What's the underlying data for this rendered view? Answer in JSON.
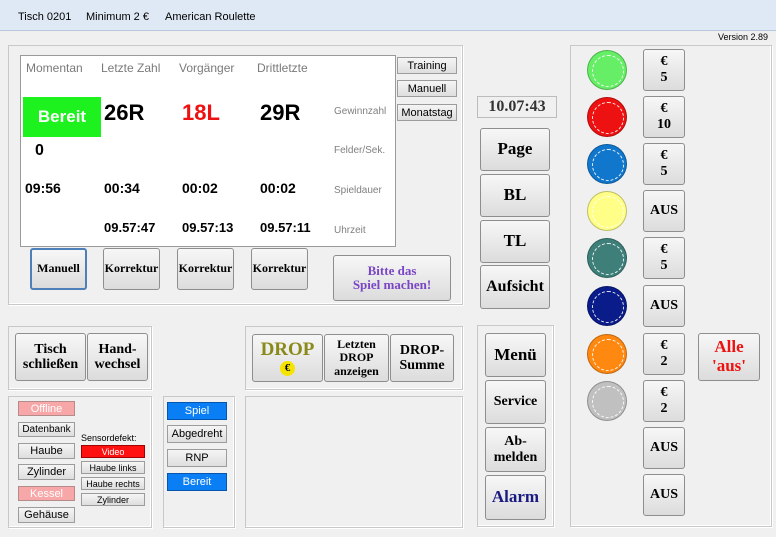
{
  "title": {
    "table": "Tisch 0201",
    "minimum": "Minimum 2 €",
    "game": "American Roulette"
  },
  "version": "Version 2.89",
  "display": {
    "headers": [
      "Momentan",
      "Letzte Zahl",
      "Vorgänger",
      "Drittletzte"
    ],
    "status": "Bereit",
    "numbers": [
      "26R",
      "18L",
      "29R"
    ],
    "number_colors": [
      "#000000",
      "#ee1111",
      "#000000"
    ],
    "fields_per_sec": "0",
    "durations": [
      "09:56",
      "00:34",
      "00:02",
      "00:02"
    ],
    "times": [
      "09.57:47",
      "09.57:13",
      "09.57:11"
    ],
    "row_labels": [
      "Gewinnzahl",
      "Felder/Sek.",
      "Spieldauer",
      "Uhrzeit"
    ]
  },
  "mode_buttons": [
    "Training",
    "Manuell",
    "Monatstag"
  ],
  "clock": "10.07:43",
  "action_buttons": [
    "Manuell",
    "Korrektur",
    "Korrektur",
    "Korrektur"
  ],
  "message": {
    "line1": "Bitte das",
    "line2": "Spiel machen!"
  },
  "nav_buttons": [
    "Page",
    "BL",
    "TL",
    "Aufsicht"
  ],
  "table_buttons": {
    "close": {
      "line1": "Tisch",
      "line2": "schließen"
    },
    "change": {
      "line1": "Hand-",
      "line2": "wechsel"
    }
  },
  "drop": {
    "label": "DROP",
    "coin": "€",
    "last": {
      "line1": "Letzten",
      "line2": "DROP",
      "line3": "anzeigen"
    },
    "sum": {
      "line1": "DROP-",
      "line2": "Summe"
    }
  },
  "menu_buttons": {
    "menu": "Menü",
    "service": "Service",
    "logout": {
      "line1": "Ab-",
      "line2": "melden"
    },
    "alarm": "Alarm"
  },
  "sensors": {
    "left": [
      "Offline",
      "Datenbank",
      "Haube",
      "Zylinder",
      "Kessel",
      "Gehäuse"
    ],
    "defect_title": "Sensordefekt:",
    "defects": [
      "Video",
      "Haube links",
      "Haube rechts",
      "Zylinder"
    ]
  },
  "game_state": [
    "Spiel",
    "Abgedreht",
    "RNP",
    "Bereit"
  ],
  "chips": [
    {
      "color": "#66ee66",
      "currency": "€",
      "value": "5"
    },
    {
      "color": "#ee1111",
      "currency": "€",
      "value": "10"
    },
    {
      "color": "#1177cc",
      "currency": "€",
      "value": "5"
    },
    {
      "color": "#ffff88",
      "currency": "",
      "value": "AUS"
    },
    {
      "color": "#3f7f7a",
      "currency": "€",
      "value": "5"
    },
    {
      "color": "#0a1b8a",
      "currency": "",
      "value": "AUS"
    },
    {
      "color": "#ff8811",
      "currency": "€",
      "value": "2"
    },
    {
      "color": "#c0c0c0",
      "currency": "€",
      "value": "2"
    },
    {
      "color": "",
      "currency": "",
      "value": "AUS"
    },
    {
      "color": "",
      "currency": "",
      "value": "AUS"
    }
  ],
  "all_off": {
    "line1": "Alle",
    "line2": "'aus'"
  }
}
